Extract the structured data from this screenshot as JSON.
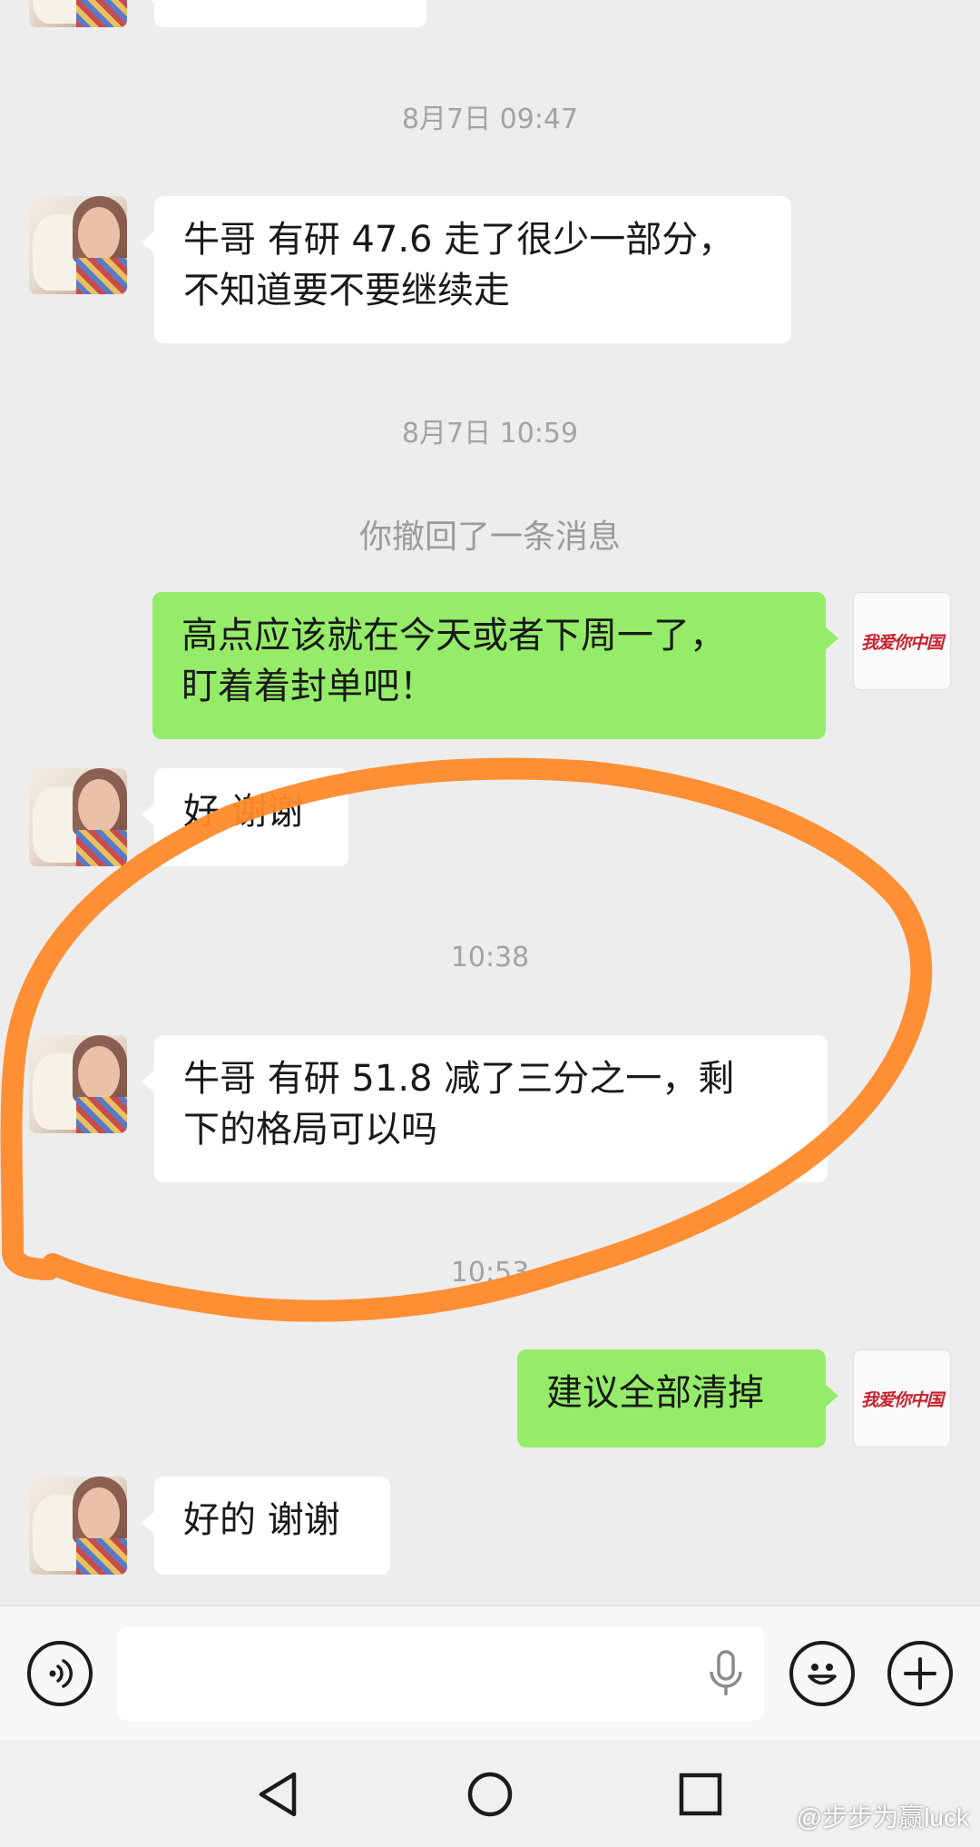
{
  "timestamps": [
    "8月7日 09:47",
    "8月7日 10:59",
    "10:38",
    "10:53"
  ],
  "system_notice": "你撤回了一条消息",
  "contact_avatar_icon": "woman-with-plush-bear-avatar",
  "self_avatar_text": "我爱你中国",
  "messages": [
    {
      "side": "left",
      "text": "牛哥 有研 47.6 走了很少一部分，\n不知道要不要继续走"
    },
    {
      "side": "right",
      "text": "高点应该就在今天或者下周一了，\n盯着着封单吧！"
    },
    {
      "side": "left",
      "text": "好 谢谢"
    },
    {
      "side": "left",
      "text": "牛哥 有研 51.8 减了三分之一，剩\n下的格局可以吗"
    },
    {
      "side": "right",
      "text": "建议全部清掉"
    },
    {
      "side": "left",
      "text": "好的 谢谢"
    }
  ],
  "annotation": {
    "shape": "hand-drawn circle",
    "color": "#ff8a2a"
  },
  "input_bar": {
    "voice_icon": "voice-icon",
    "mic_icon": "microphone-icon",
    "emoji_icon": "emoji-icon",
    "plus_icon": "plus-icon"
  },
  "nav": {
    "back_icon": "back-icon",
    "home_icon": "home-icon",
    "recents_icon": "recents-icon"
  },
  "watermark": "@步步为赢luck",
  "colors": {
    "background": "#ededed",
    "incoming_bubble": "#ffffff",
    "outgoing_bubble": "#95ec69",
    "timestamp": "#a3a3a3"
  }
}
